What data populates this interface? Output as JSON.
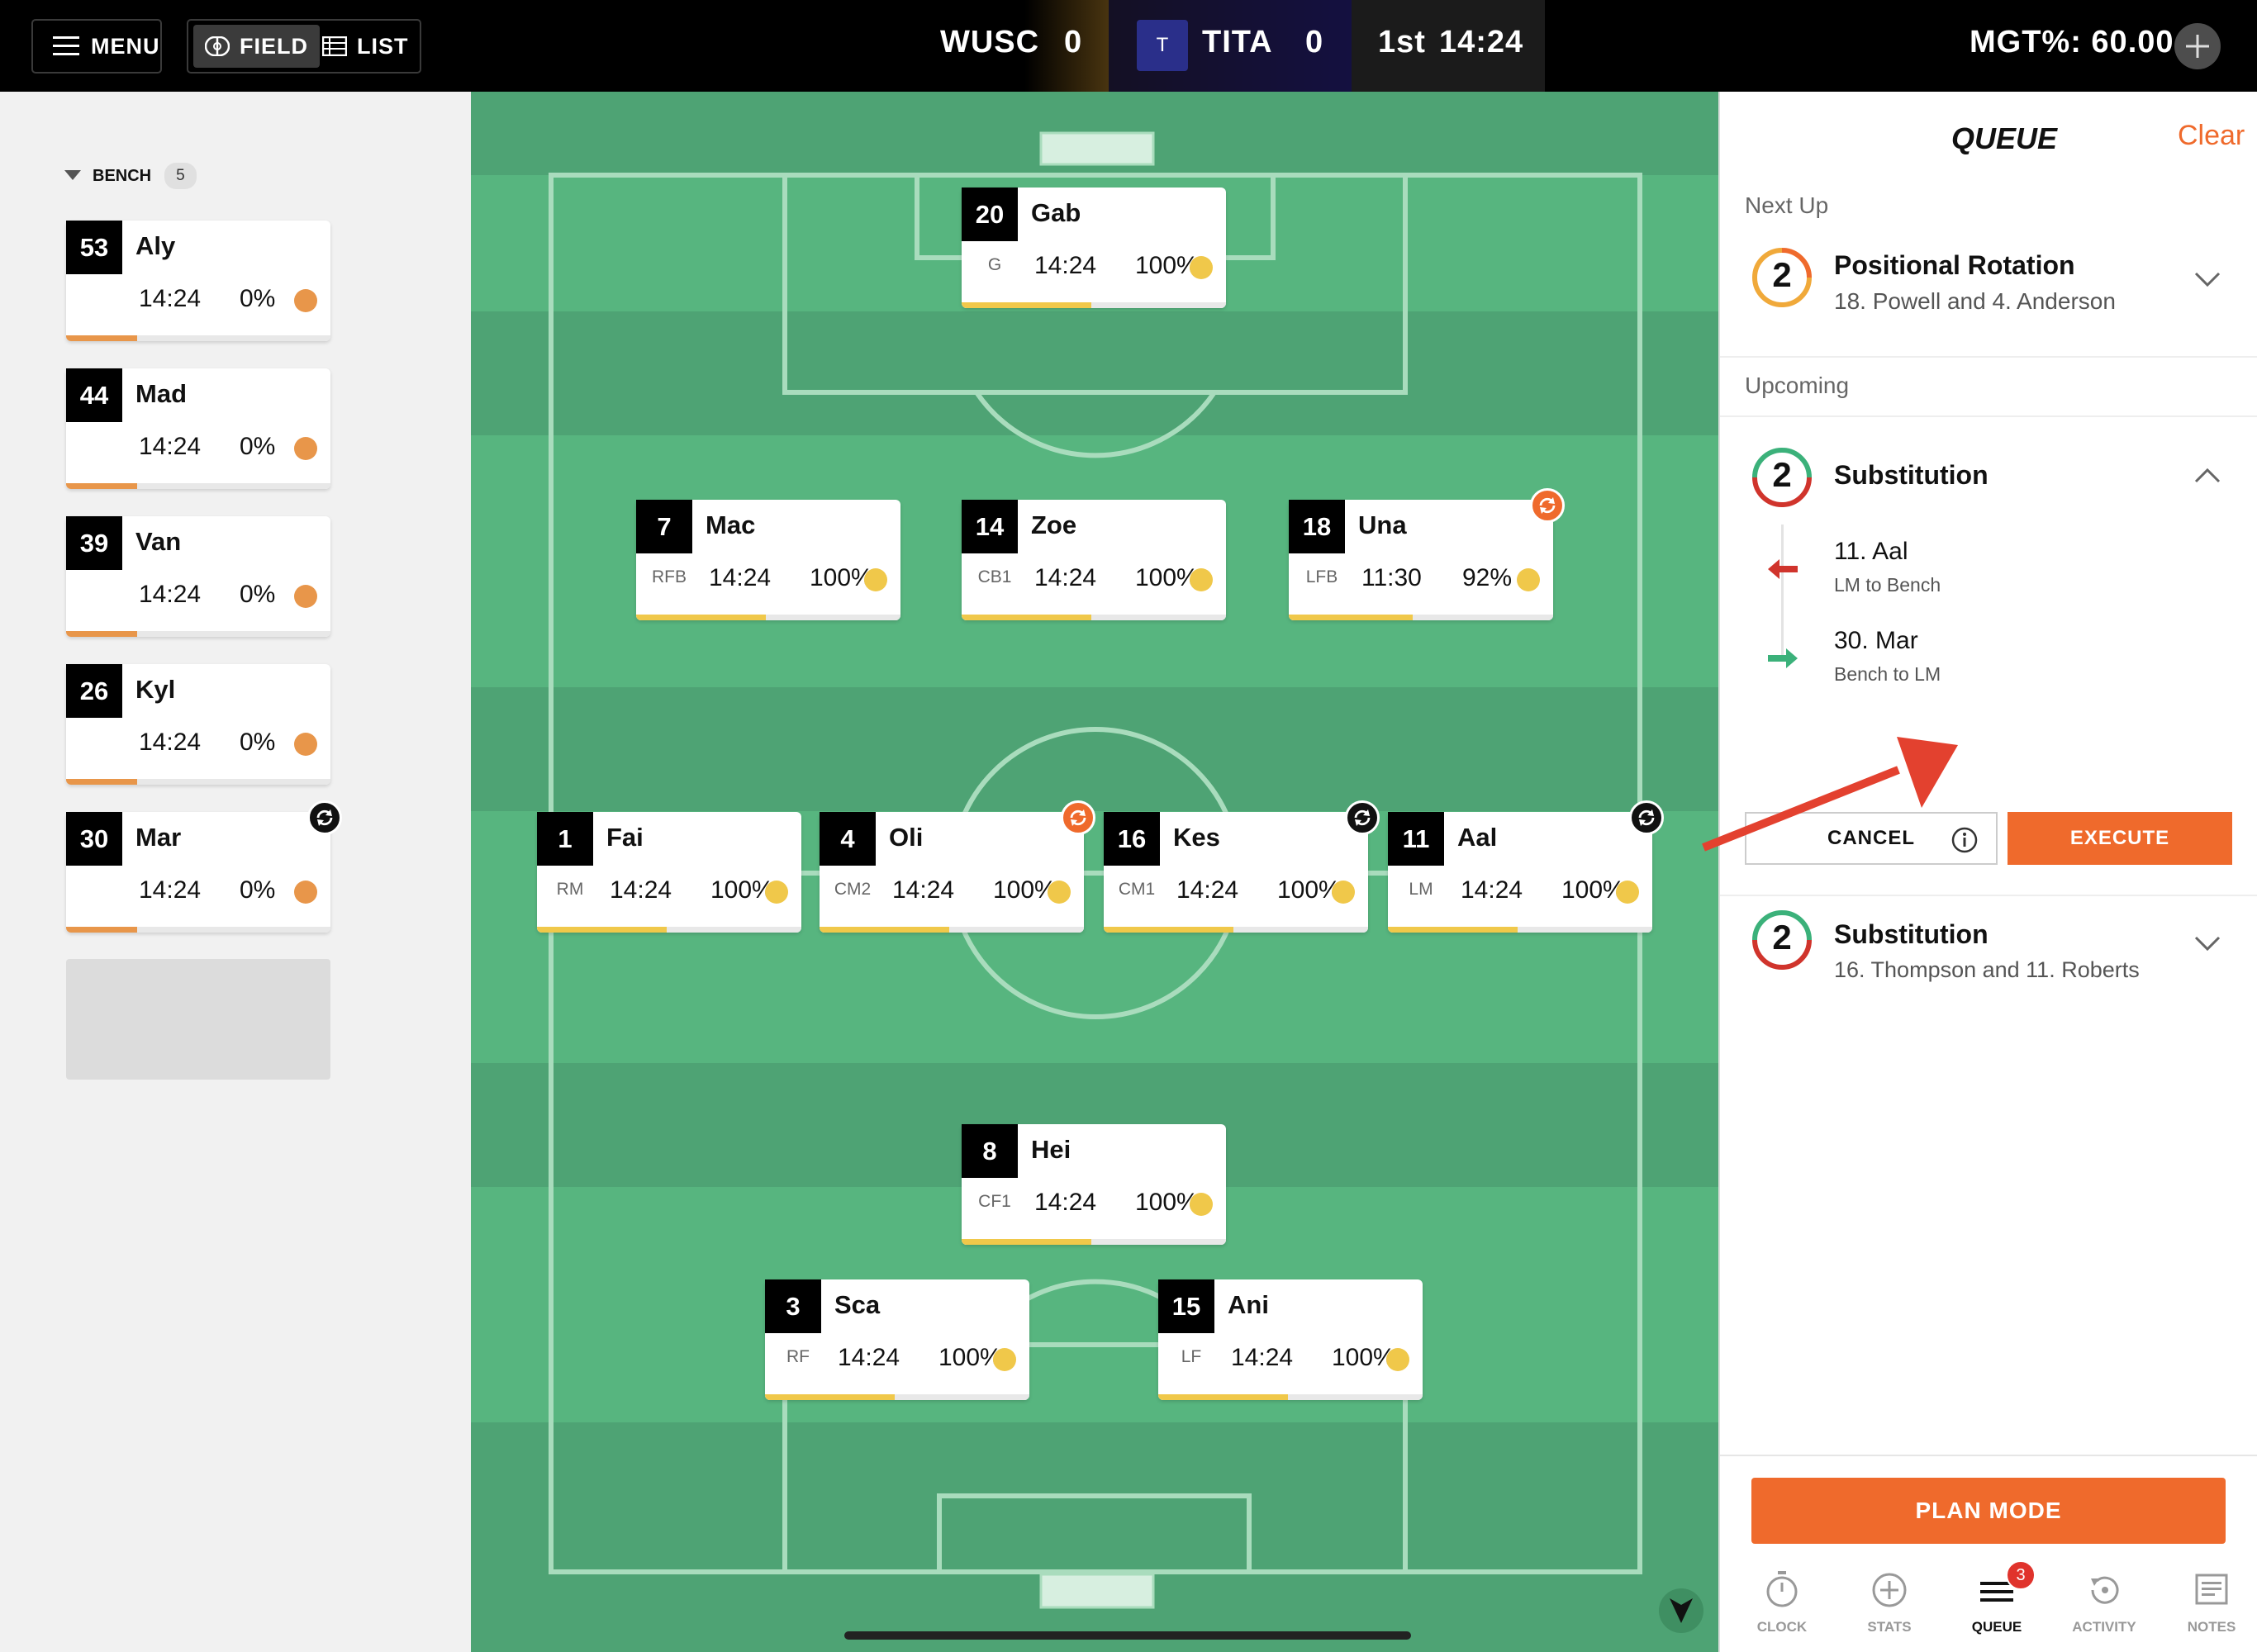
{
  "topbar": {
    "menu_label": "MENU",
    "field_label": "FIELD",
    "list_label": "LIST",
    "home_team": "WUSC",
    "home_score": "0",
    "away_badge": "T",
    "away_team": "TITA",
    "away_score": "0",
    "period": "1st",
    "clock": "14:24",
    "mgt_label": "MGT%: 60.00"
  },
  "bench": {
    "label": "BENCH",
    "count": "5",
    "players": [
      {
        "number": "53",
        "name": "Aly",
        "time": "14:24",
        "pct": "0%",
        "fill": 0.27
      },
      {
        "number": "44",
        "name": "Mad",
        "time": "14:24",
        "pct": "0%",
        "fill": 0.27
      },
      {
        "number": "39",
        "name": "Van",
        "time": "14:24",
        "pct": "0%",
        "fill": 0.27
      },
      {
        "number": "26",
        "name": "Kyl",
        "time": "14:24",
        "pct": "0%",
        "fill": 0.27
      },
      {
        "number": "30",
        "name": "Mar",
        "time": "14:24",
        "pct": "0%",
        "fill": 0.27,
        "swap": "pending"
      }
    ]
  },
  "field": {
    "players": [
      {
        "number": "20",
        "name": "Gab",
        "pos": "G",
        "time": "14:24",
        "pct": "100%",
        "fill": 0.49
      },
      {
        "number": "7",
        "name": "Mac",
        "pos": "RFB",
        "time": "14:24",
        "pct": "100%",
        "fill": 0.49
      },
      {
        "number": "14",
        "name": "Zoe",
        "pos": "CB1",
        "time": "14:24",
        "pct": "100%",
        "fill": 0.49
      },
      {
        "number": "18",
        "name": "Una",
        "pos": "LFB",
        "time": "11:30",
        "pct": "92%",
        "fill": 0.47,
        "swap": "rotation"
      },
      {
        "number": "1",
        "name": "Fai",
        "pos": "RM",
        "time": "14:24",
        "pct": "100%",
        "fill": 0.49
      },
      {
        "number": "4",
        "name": "Oli",
        "pos": "CM2",
        "time": "14:24",
        "pct": "100%",
        "fill": 0.49,
        "swap": "rotation"
      },
      {
        "number": "16",
        "name": "Kes",
        "pos": "CM1",
        "time": "14:24",
        "pct": "100%",
        "fill": 0.49,
        "swap": "pending"
      },
      {
        "number": "11",
        "name": "Aal",
        "pos": "LM",
        "time": "14:24",
        "pct": "100%",
        "fill": 0.49,
        "swap": "pending"
      },
      {
        "number": "8",
        "name": "Hei",
        "pos": "CF1",
        "time": "14:24",
        "pct": "100%",
        "fill": 0.49
      },
      {
        "number": "3",
        "name": "Sca",
        "pos": "RF",
        "time": "14:24",
        "pct": "100%",
        "fill": 0.49
      },
      {
        "number": "15",
        "name": "Ani",
        "pos": "LF",
        "time": "14:24",
        "pct": "100%",
        "fill": 0.49
      }
    ]
  },
  "queue": {
    "title": "QUEUE",
    "clear_label": "Clear",
    "next_up_label": "Next Up",
    "next_item": {
      "count": "2",
      "title": "Positional Rotation",
      "subtitle": "18. Powell and 4. Anderson"
    },
    "upcoming_label": "Upcoming",
    "expanded_item": {
      "count": "2",
      "title": "Substitution",
      "out_player": "11. Aal",
      "out_detail": "LM to Bench",
      "in_player": "30. Mar",
      "in_detail": "Bench to LM",
      "cancel_label": "CANCEL",
      "execute_label": "EXECUTE"
    },
    "collapsed_item": {
      "count": "2",
      "title": "Substitution",
      "subtitle": "16. Thompson and 11. Roberts"
    },
    "plan_mode_label": "PLAN MODE",
    "nav": [
      {
        "label": "CLOCK",
        "icon": "stopwatch-icon"
      },
      {
        "label": "STATS",
        "icon": "plus-circle-icon"
      },
      {
        "label": "QUEUE",
        "icon": "queue-list-icon",
        "badge": "3"
      },
      {
        "label": "ACTIVITY",
        "icon": "history-icon"
      },
      {
        "label": "NOTES",
        "icon": "notes-icon"
      }
    ]
  },
  "colors": {
    "accent_orange": "#ef6a2c",
    "bench_dot": "#e8964a",
    "field_dot": "#f0c84a",
    "field_green": "#57b57f",
    "out_red": "#d0342c",
    "in_green": "#3bb17a"
  }
}
